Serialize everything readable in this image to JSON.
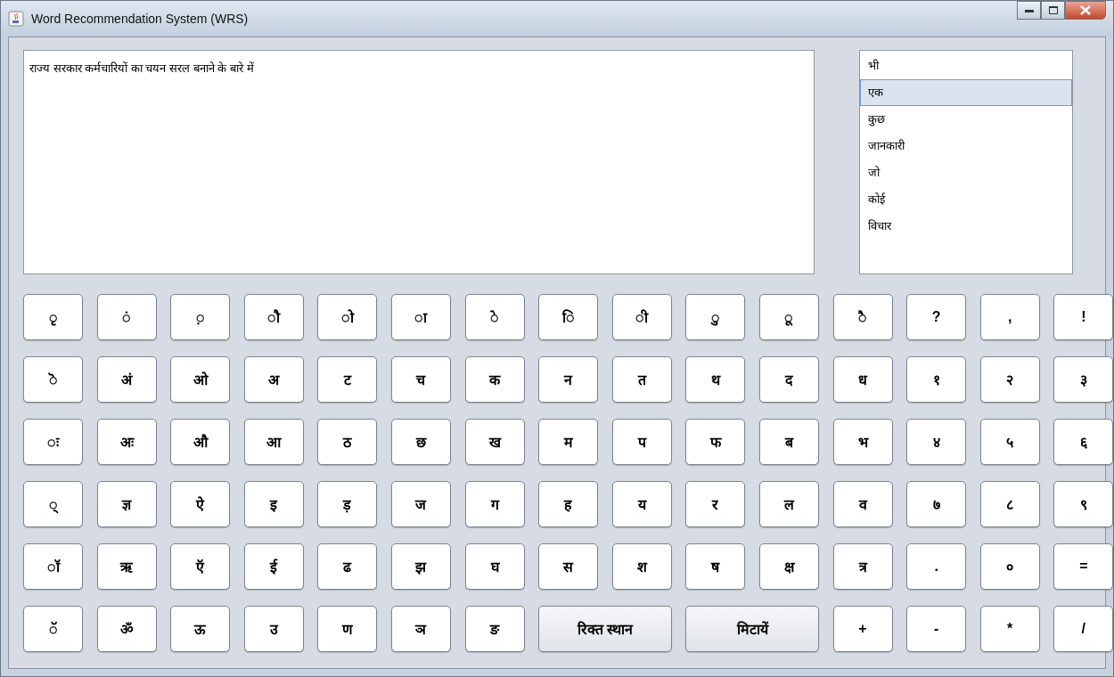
{
  "window": {
    "title": "Word Recommendation System (WRS)"
  },
  "editor": {
    "value": "राज्य सरकार कर्मचारियों का चयन सरल बनाने के बारे में"
  },
  "suggestions": [
    {
      "word": "भी",
      "selected": false
    },
    {
      "word": "एक",
      "selected": true
    },
    {
      "word": "कुछ",
      "selected": false
    },
    {
      "word": "जानकारी",
      "selected": false
    },
    {
      "word": "जो",
      "selected": false
    },
    {
      "word": "कोई",
      "selected": false
    },
    {
      "word": "विचार",
      "selected": false
    }
  ],
  "keyboard": [
    [
      {
        "kind": "char",
        "label": "◌ृ"
      },
      {
        "kind": "char",
        "label": "◌ं"
      },
      {
        "kind": "char",
        "label": "◌़"
      },
      {
        "kind": "char",
        "label": "◌ौ"
      },
      {
        "kind": "char",
        "label": "◌ो"
      },
      {
        "kind": "char",
        "label": "◌ा"
      },
      {
        "kind": "char",
        "label": "◌े"
      },
      {
        "kind": "char",
        "label": "◌ि"
      },
      {
        "kind": "char",
        "label": "◌ी"
      },
      {
        "kind": "char",
        "label": "◌ु"
      },
      {
        "kind": "char",
        "label": "◌ू"
      },
      {
        "kind": "char",
        "label": "◌ै"
      },
      {
        "kind": "char",
        "label": "?"
      },
      {
        "kind": "char",
        "label": ","
      },
      {
        "kind": "char",
        "label": "!"
      }
    ],
    [
      {
        "kind": "char",
        "label": "◌ॆ"
      },
      {
        "kind": "char",
        "label": "अं"
      },
      {
        "kind": "char",
        "label": "ओ"
      },
      {
        "kind": "char",
        "label": "अ"
      },
      {
        "kind": "char",
        "label": "ट"
      },
      {
        "kind": "char",
        "label": "च"
      },
      {
        "kind": "char",
        "label": "क"
      },
      {
        "kind": "char",
        "label": "न"
      },
      {
        "kind": "char",
        "label": "त"
      },
      {
        "kind": "char",
        "label": "थ"
      },
      {
        "kind": "char",
        "label": "द"
      },
      {
        "kind": "char",
        "label": "ध"
      },
      {
        "kind": "char",
        "label": "१"
      },
      {
        "kind": "char",
        "label": "२"
      },
      {
        "kind": "char",
        "label": "३"
      }
    ],
    [
      {
        "kind": "char",
        "label": "◌ः"
      },
      {
        "kind": "char",
        "label": "अः"
      },
      {
        "kind": "char",
        "label": "औ"
      },
      {
        "kind": "char",
        "label": "आ"
      },
      {
        "kind": "char",
        "label": "ठ"
      },
      {
        "kind": "char",
        "label": "छ"
      },
      {
        "kind": "char",
        "label": "ख"
      },
      {
        "kind": "char",
        "label": "म"
      },
      {
        "kind": "char",
        "label": "प"
      },
      {
        "kind": "char",
        "label": "फ"
      },
      {
        "kind": "char",
        "label": "ब"
      },
      {
        "kind": "char",
        "label": "भ"
      },
      {
        "kind": "char",
        "label": "४"
      },
      {
        "kind": "char",
        "label": "५"
      },
      {
        "kind": "char",
        "label": "६"
      }
    ],
    [
      {
        "kind": "char",
        "label": "◌्"
      },
      {
        "kind": "char",
        "label": "ज्ञ"
      },
      {
        "kind": "char",
        "label": "ऐ"
      },
      {
        "kind": "char",
        "label": "इ"
      },
      {
        "kind": "char",
        "label": "ड़"
      },
      {
        "kind": "char",
        "label": "ज"
      },
      {
        "kind": "char",
        "label": "ग"
      },
      {
        "kind": "char",
        "label": "ह"
      },
      {
        "kind": "char",
        "label": "य"
      },
      {
        "kind": "char",
        "label": "र"
      },
      {
        "kind": "char",
        "label": "ल"
      },
      {
        "kind": "char",
        "label": "व"
      },
      {
        "kind": "char",
        "label": "७"
      },
      {
        "kind": "char",
        "label": "८"
      },
      {
        "kind": "char",
        "label": "९"
      }
    ],
    [
      {
        "kind": "char",
        "label": "◌ॉ"
      },
      {
        "kind": "char",
        "label": "ऋ"
      },
      {
        "kind": "char",
        "label": "ऍ"
      },
      {
        "kind": "char",
        "label": "ई"
      },
      {
        "kind": "char",
        "label": "ढ"
      },
      {
        "kind": "char",
        "label": "झ"
      },
      {
        "kind": "char",
        "label": "घ"
      },
      {
        "kind": "char",
        "label": "स"
      },
      {
        "kind": "char",
        "label": "श"
      },
      {
        "kind": "char",
        "label": "ष"
      },
      {
        "kind": "char",
        "label": "क्ष"
      },
      {
        "kind": "char",
        "label": "त्र"
      },
      {
        "kind": "char",
        "label": "."
      },
      {
        "kind": "char",
        "label": "०"
      },
      {
        "kind": "char",
        "label": "="
      }
    ],
    [
      {
        "kind": "char",
        "label": "◌ॅ"
      },
      {
        "kind": "char",
        "label": "ॐ"
      },
      {
        "kind": "char",
        "label": "ऊ"
      },
      {
        "kind": "char",
        "label": "उ"
      },
      {
        "kind": "char",
        "label": "ण"
      },
      {
        "kind": "char",
        "label": "ञ"
      },
      {
        "kind": "char",
        "label": "ङ"
      },
      {
        "kind": "wide",
        "label": "रिक्त स्थान"
      },
      {
        "kind": "wide",
        "label": "मिटायें"
      },
      {
        "kind": "char",
        "label": "+"
      },
      {
        "kind": "char",
        "label": "-"
      },
      {
        "kind": "char",
        "label": "*"
      },
      {
        "kind": "char",
        "label": "/"
      }
    ]
  ]
}
